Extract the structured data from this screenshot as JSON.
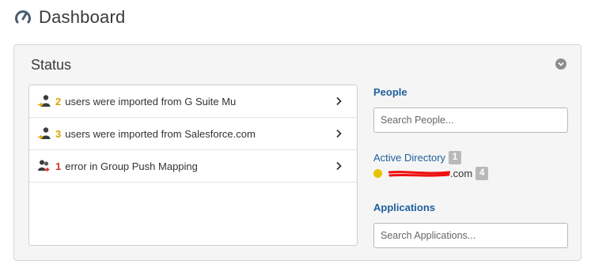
{
  "header": {
    "title": "Dashboard",
    "logo_icon": "gauge-icon"
  },
  "status_panel": {
    "title": "Status",
    "collapse_icon": "chevron-down-circle-icon",
    "items": [
      {
        "icon": "user-import-icon",
        "count": "2",
        "count_kind": "warning",
        "text": "users were imported from G Suite Mu"
      },
      {
        "icon": "user-import-icon",
        "count": "3",
        "count_kind": "warning",
        "text": "users were imported from Salesforce.com"
      },
      {
        "icon": "group-push-error-icon",
        "count": "1",
        "count_kind": "error",
        "text": "error in Group Push Mapping"
      }
    ]
  },
  "people": {
    "heading": "People",
    "search_placeholder": "Search People..."
  },
  "directory": {
    "label": "Active Directory",
    "count": "1",
    "domain_suffix": ".com",
    "domain_count": "4",
    "status_color": "#e7c300"
  },
  "applications": {
    "heading": "Applications",
    "search_placeholder": "Search Applications..."
  },
  "colors": {
    "accent": "#1f5f9c",
    "warning": "#d6a300",
    "error": "#d9302c",
    "redaction": "#ee1111"
  }
}
